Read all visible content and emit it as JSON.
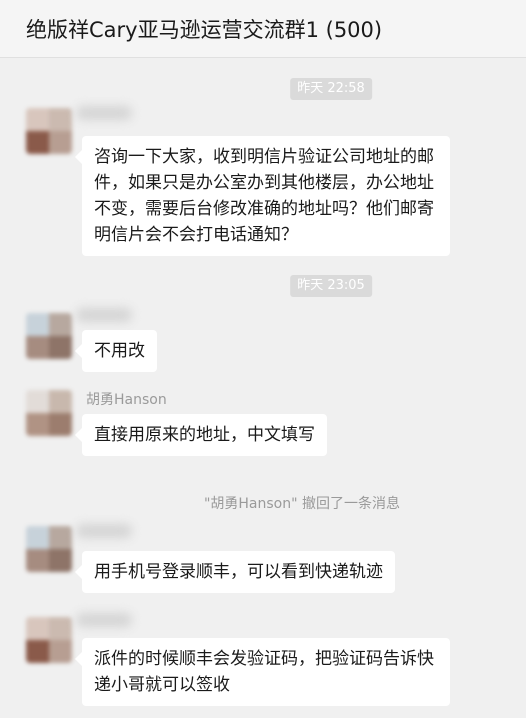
{
  "header": {
    "title": "绝版祥Cary亚马逊运营交流群1 (500)"
  },
  "times": [
    "昨天 22:58",
    "昨天 23:05"
  ],
  "messages": [
    {
      "text": "咨询一下大家，收到明信片验证公司地址的邮件，如果只是办公室办到其他楼层，办公地址不变，需要后台修改准确的地址吗？他们邮寄明信片会不会打电话通知？"
    },
    {
      "text": "不用改"
    },
    {
      "sender": "胡勇Hanson",
      "text": "直接用原来的地址，中文填写"
    },
    {
      "text": "用手机号登录顺丰，可以看到快递轨迹"
    },
    {
      "text": "派件的时候顺丰会发验证码，把验证码告诉快递小哥就可以签收"
    }
  ],
  "recall_notice": "\"胡勇Hanson\" 撤回了一条消息"
}
